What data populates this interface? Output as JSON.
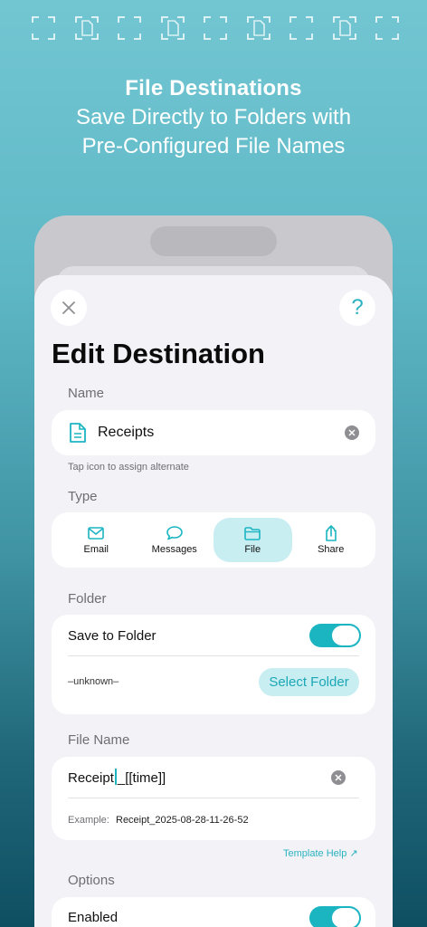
{
  "banner": {
    "title": "File Destinations",
    "subtitle_line1": "Save Directly to Folders with",
    "subtitle_line2": "Pre-Configured File Names",
    "icons": [
      "scan-frame-icon",
      "scan-document-icon",
      "scan-frame-icon",
      "scan-document-icon",
      "scan-frame-icon",
      "scan-document-icon",
      "scan-frame-icon",
      "scan-document-icon",
      "scan-frame-icon"
    ]
  },
  "header": {
    "title": "Edit Destination",
    "close_icon": "close-icon",
    "help_label": "?"
  },
  "name_section": {
    "label": "Name",
    "value": "Receipts",
    "hint": "Tap icon to assign alternate"
  },
  "type_section": {
    "label": "Type",
    "options": [
      {
        "label": "Email",
        "icon": "envelope-icon",
        "selected": false
      },
      {
        "label": "Messages",
        "icon": "message-bubble-icon",
        "selected": false
      },
      {
        "label": "File",
        "icon": "folder-icon",
        "selected": true
      },
      {
        "label": "Share",
        "icon": "share-icon",
        "selected": false
      }
    ]
  },
  "folder_section": {
    "label": "Folder",
    "save_to_folder_label": "Save to Folder",
    "save_to_folder_on": true,
    "folder_value": "–unknown–",
    "select_button": "Select Folder"
  },
  "file_name_section": {
    "label": "File Name",
    "value_before_caret": "Receipt",
    "value_after_caret": "_[[time]]",
    "example_label": "Example:",
    "example_value": "Receipt_2025-08-28-11-26-52",
    "template_help": "Template Help ↗"
  },
  "options_section": {
    "label": "Options",
    "enabled_label": "Enabled",
    "enabled_on": true
  },
  "colors": {
    "accent": "#1bb5c2",
    "accent_light": "#c8eef2",
    "sheet_bg": "#f2f2f7"
  }
}
